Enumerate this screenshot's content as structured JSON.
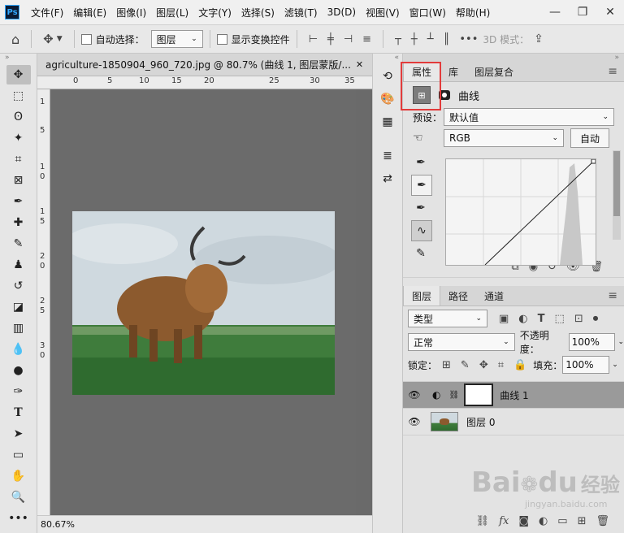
{
  "app": {
    "logo": "Ps",
    "menus": [
      "文件(F)",
      "编辑(E)",
      "图像(I)",
      "图层(L)",
      "文字(Y)",
      "选择(S)",
      "滤镜(T)",
      "3D(D)",
      "视图(V)",
      "窗口(W)",
      "帮助(H)"
    ],
    "window_controls": [
      "—",
      "❐",
      "✕"
    ]
  },
  "options": {
    "auto_select_label": "自动选择：",
    "auto_select_dropdown": "图层",
    "show_transform_label": "显示变换控件",
    "mode_3d_label": "3D 模式："
  },
  "document": {
    "tab_title": "agriculture-1850904_960_720.jpg @ 80.7% (曲线 1, 图层蒙版/...",
    "close": "✕",
    "zoom": "80.67%",
    "ruler_h": [
      "0",
      "5",
      "10",
      "15",
      "20",
      "25",
      "30",
      "35"
    ],
    "ruler_v": [
      "1",
      "5",
      "1",
      "0",
      "1",
      "5",
      "2",
      "0",
      "2",
      "5",
      "3",
      "0"
    ]
  },
  "properties": {
    "tabs": [
      "属性",
      "库",
      "图层复合"
    ],
    "adjustment_title": "曲线",
    "preset_label": "预设：",
    "preset_value": "默认值",
    "channel_value": "RGB",
    "auto_button": "自动"
  },
  "layers": {
    "tabs": [
      "图层",
      "路径",
      "通道"
    ],
    "filter_type": "类型",
    "blend_mode": "正常",
    "opacity_label": "不透明度：",
    "opacity_value": "100%",
    "lock_label": "锁定：",
    "fill_label": "填充：",
    "fill_value": "100%",
    "items": [
      {
        "name": "曲线 1",
        "selected": true
      },
      {
        "name": "图层 0",
        "selected": false
      }
    ]
  },
  "watermark": {
    "text": "Bai",
    "text2": "du",
    "text3": "经验",
    "url": "jingyan.baidu.com"
  },
  "colors": {
    "selection_highlight": "#e23b3b",
    "photoshop_blue": "#31a8ff"
  }
}
